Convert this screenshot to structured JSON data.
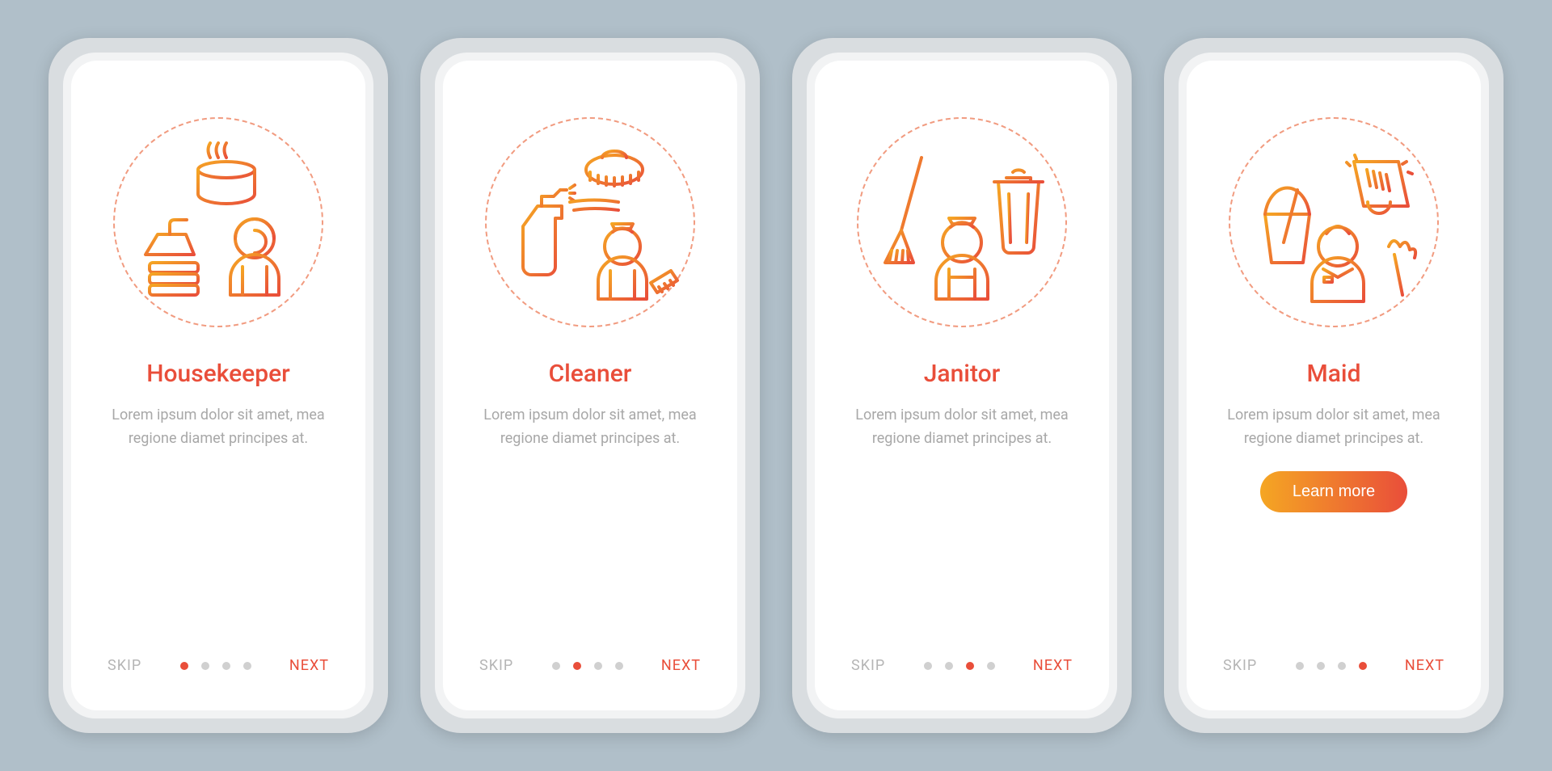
{
  "screens": [
    {
      "title": "Housekeeper",
      "description": "Lorem ipsum dolor sit amet, mea regione diamet principes at.",
      "skip": "SKIP",
      "next": "NEXT",
      "activeDot": 0,
      "icon": "housekeeper-icon"
    },
    {
      "title": "Cleaner",
      "description": "Lorem ipsum dolor sit amet, mea regione diamet principes at.",
      "skip": "SKIP",
      "next": "NEXT",
      "activeDot": 1,
      "icon": "cleaner-icon"
    },
    {
      "title": "Janitor",
      "description": "Lorem ipsum dolor sit amet, mea regione diamet principes at.",
      "skip": "SKIP",
      "next": "NEXT",
      "activeDot": 2,
      "icon": "janitor-icon"
    },
    {
      "title": "Maid",
      "description": "Lorem ipsum dolor sit amet, mea regione diamet principes at.",
      "skip": "SKIP",
      "next": "NEXT",
      "activeDot": 3,
      "icon": "maid-icon",
      "cta": "Learn more"
    }
  ],
  "dotsCount": 4,
  "colors": {
    "accent": "#e94e3a",
    "gradientStart": "#f5a623",
    "gradientEnd": "#e94e3a",
    "muted": "#a8a8a8",
    "background": "#b0bfc9"
  }
}
